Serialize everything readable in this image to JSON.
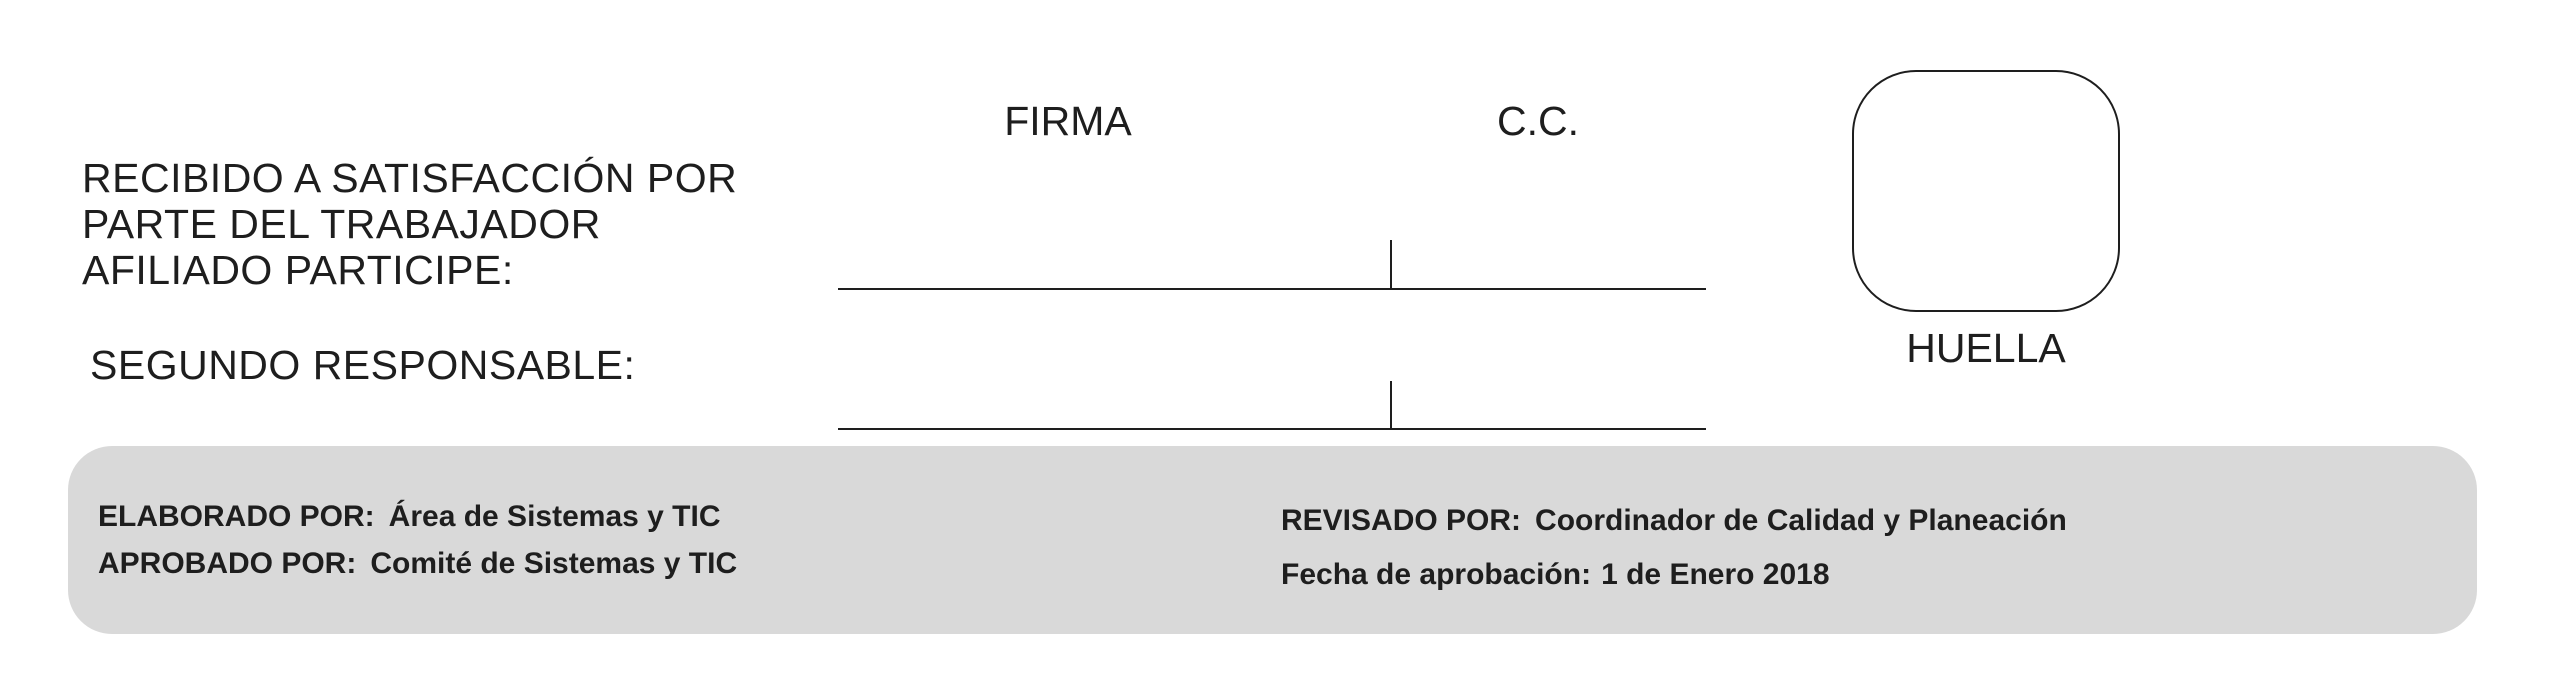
{
  "signature_section": {
    "received_label_lines": [
      "RECIBIDO A SATISFACCIÓN POR",
      "PARTE DEL TRABAJADOR",
      "AFILIADO PARTICIPE:"
    ],
    "second_responsible_label": "SEGUNDO RESPONSABLE:",
    "column_signature": "FIRMA",
    "column_id": "C.C.",
    "fingerprint_label": "HUELLA"
  },
  "footer": {
    "elaborated_label": "ELABORADO POR:",
    "elaborated_value": "Área de Sistemas y TIC",
    "approved_label": "APROBADO POR:",
    "approved_value": "Comité de Sistemas y TIC",
    "reviewed_label": "REVISADO POR:",
    "reviewed_value": "Coordinador de Calidad y Planeación",
    "approval_date_label": "Fecha de aprobación:",
    "approval_date_value": "1 de Enero 2018"
  },
  "colors": {
    "ink": "#1e1e1e",
    "footer_background": "#d9d9d9"
  }
}
